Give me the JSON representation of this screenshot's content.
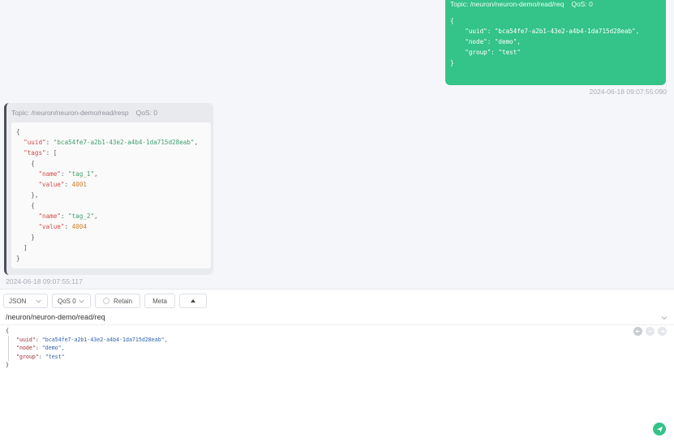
{
  "sent_message": {
    "topic": "Topic: /neuron/neuron-demo/read/req",
    "qos": "QoS: 0",
    "payload": "{\n    \"uuid\": \"bca54fe7-a2b1-43e2-a4b4-1da715d28eab\",\n    \"node\": \"demo\",\n    \"group\": \"test\"\n}",
    "timestamp": "2024-06-18 09:07:55:090"
  },
  "received_message": {
    "topic": "Topic: /neuron/neuron-demo/read/resp",
    "qos": "QoS: 0",
    "uuid": "bca54fe7-a2b1-43e2-a4b4-1da715d28eab",
    "tags": [
      {
        "name": "tag_1",
        "value": "4001"
      },
      {
        "name": "tag_2",
        "value": "4004"
      }
    ],
    "timestamp": "2024-06-18 09:07:55:117"
  },
  "composer": {
    "format_select": "JSON",
    "qos_select": "QoS 0",
    "retain_label": "Retain",
    "meta_label": "Meta",
    "topic": "/neuron/neuron-demo/read/req",
    "payload_open": "{",
    "payload_close": "}",
    "payload_lines": [
      {
        "key": "\"uuid\"",
        "value": "\"bca54fe7-a2b1-43e2-a4b4-1da715d28eab\","
      },
      {
        "key": "\"node\"",
        "value": "\"demo\","
      },
      {
        "key": "\"group\"",
        "value": "\"test\""
      }
    ]
  },
  "icons": {
    "chevron": "chevron-down-icon",
    "expand": "triangle-up-icon",
    "history_back": "arrow-left-icon",
    "history_clear": "minus-icon",
    "history_forward": "arrow-right-icon",
    "send": "send-icon"
  },
  "colors": {
    "accent": "#34c388",
    "received_border": "#4b4f57"
  }
}
